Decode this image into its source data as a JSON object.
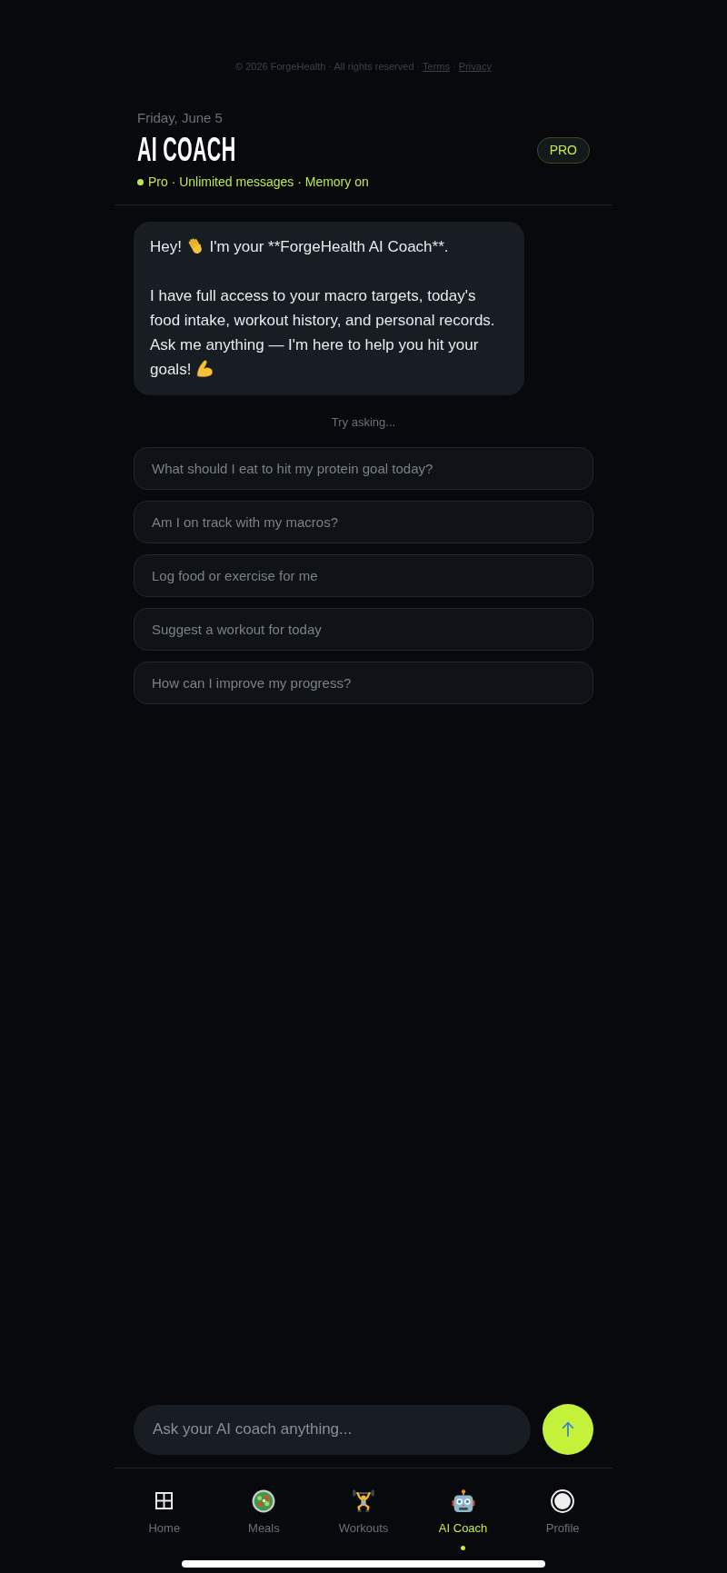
{
  "footer": {
    "text": "© 2026 ForgeHealth · All rights reserved",
    "separator": "·",
    "links": [
      "Terms",
      "Privacy"
    ]
  },
  "header": {
    "date": "Friday, June 5",
    "title": "AI COACH",
    "status": "Pro · Unlimited messages · Memory on",
    "badge": "PRO"
  },
  "messages": [
    {
      "paragraphs": [
        {
          "segments": [
            {
              "kind": "text",
              "text": "Hey!"
            },
            {
              "kind": "wave"
            },
            {
              "kind": "text",
              "text": "I'm your **ForgeHealth AI Coach**."
            }
          ]
        },
        {
          "segments": [
            {
              "kind": "text",
              "text": "I have full access to your macro targets, today's food intake, workout history, and personal records. Ask me anything — I'm here to help you hit your"
            },
            {
              "kind": "text",
              "text": "goals!"
            },
            {
              "kind": "flex"
            }
          ]
        }
      ]
    }
  ],
  "suggestions": {
    "label": "Try asking...",
    "items": [
      "What should I eat to hit my protein goal today?",
      "Am I on track with my macros?",
      "Log food or exercise for me",
      "Suggest a workout for today",
      "How can I improve my progress?"
    ]
  },
  "composer": {
    "placeholder": "Ask your AI coach anything..."
  },
  "nav": [
    {
      "kind": "home",
      "label": "Home",
      "selected": false
    },
    {
      "kind": "meals",
      "label": "Meals",
      "selected": false
    },
    {
      "kind": "workouts",
      "label": "Workouts",
      "selected": false
    },
    {
      "kind": "coach",
      "label": "AI Coach",
      "selected": true
    },
    {
      "kind": "profile",
      "label": "Profile",
      "selected": false
    }
  ]
}
